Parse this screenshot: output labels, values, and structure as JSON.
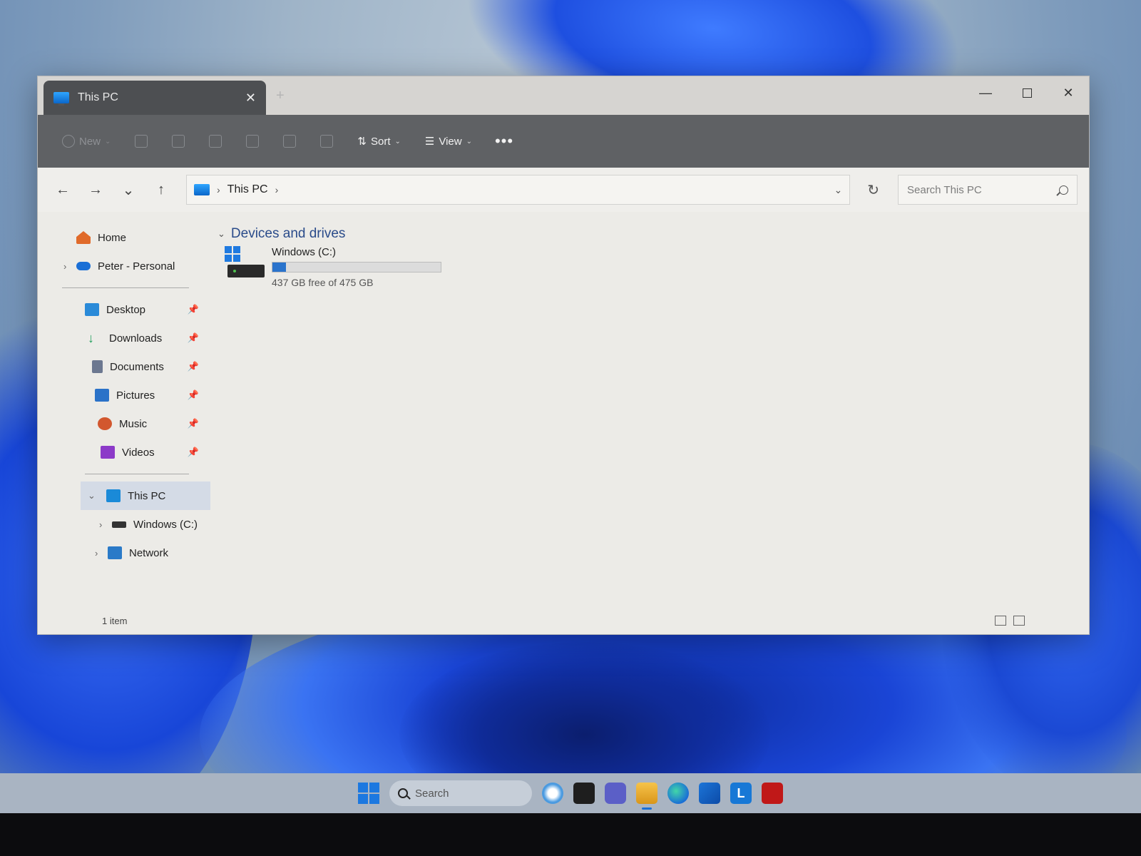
{
  "window": {
    "tab_title": "This PC",
    "new_tab": "+",
    "close": "✕",
    "minimize": "—",
    "close_window": "✕"
  },
  "toolbar": {
    "new_label": "New",
    "sort_label": "Sort",
    "view_label": "View",
    "more_label": "•••"
  },
  "nav": {
    "back": "←",
    "forward": "→",
    "recent": "⌄",
    "up": "↑",
    "breadcrumb": "This PC",
    "sep": "›",
    "refresh": "↻",
    "search_placeholder": "Search This PC"
  },
  "sidebar": {
    "home": "Home",
    "onedrive": "Peter - Personal",
    "pinned": [
      {
        "label": "Desktop",
        "icon": "desktop-icon",
        "color": "#2a8ad8"
      },
      {
        "label": "Downloads",
        "icon": "downloads-icon",
        "color": "#1e9e5a"
      },
      {
        "label": "Documents",
        "icon": "documents-icon",
        "color": "#6c7890"
      },
      {
        "label": "Pictures",
        "icon": "pictures-icon",
        "color": "#2a72c8"
      },
      {
        "label": "Music",
        "icon": "music-icon",
        "color": "#d2572e"
      },
      {
        "label": "Videos",
        "icon": "videos-icon",
        "color": "#8c3ac8"
      }
    ],
    "this_pc": "This PC",
    "windows_c": "Windows (C:)",
    "network": "Network"
  },
  "content": {
    "section": "Devices and drives",
    "drive_name": "Windows (C:)",
    "drive_free": "437 GB free of 475 GB",
    "drive_used_fraction": 0.08
  },
  "status": {
    "count": "1 item"
  },
  "taskbar": {
    "search_label": "Search"
  }
}
